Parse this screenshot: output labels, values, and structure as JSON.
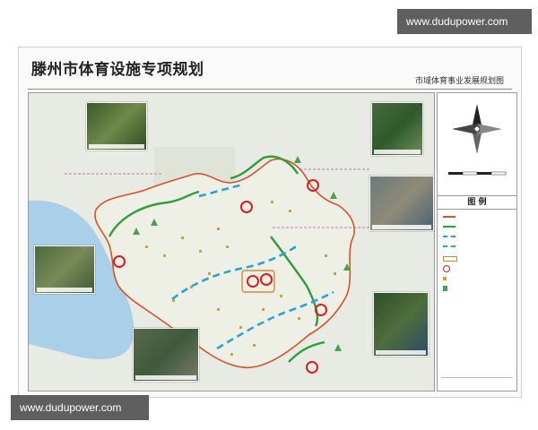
{
  "watermark": {
    "top": "www.dudupower.com",
    "bottom": "www.dudupower.com"
  },
  "header": {
    "title": "滕州市体育设施专项规划",
    "subtitle": "市域体育事业发展规划图"
  },
  "legend": {
    "title": "图 例"
  },
  "colors": {
    "boundary": "#d9522a",
    "green_route": "#2e9e3a",
    "blue_route": "#2ba3d6",
    "node_ring": "#d42020",
    "venue_dot": "#c8a53c",
    "lake": "#a9cfe9",
    "purple_link": "#b04fb8"
  },
  "icons": [
    "north-arrow-icon",
    "scale-bar-icon",
    "tree-icon"
  ]
}
